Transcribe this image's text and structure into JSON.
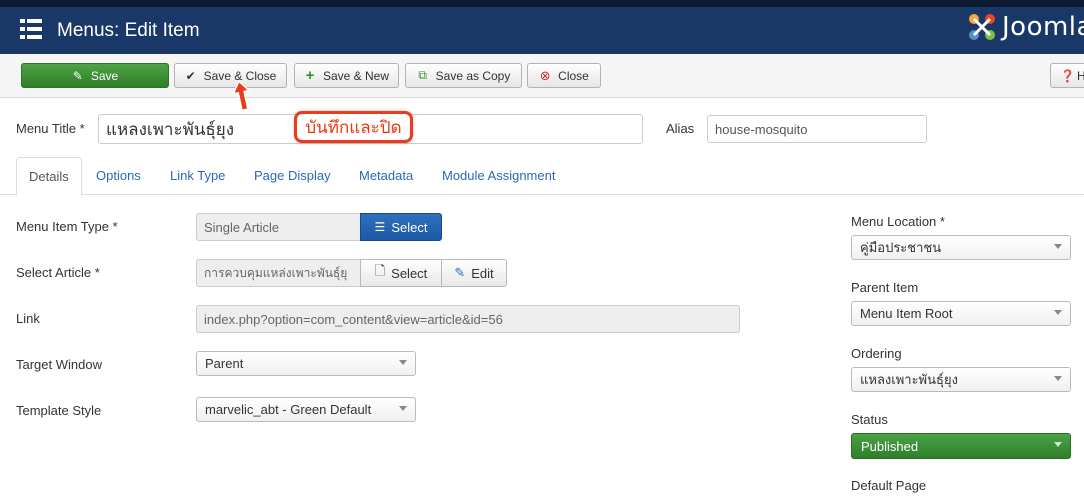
{
  "header": {
    "title": "Menus: Edit Item",
    "logo_text": "Joomla"
  },
  "toolbar": {
    "save": "Save",
    "save_close": "Save & Close",
    "save_new": "Save & New",
    "save_copy": "Save as Copy",
    "close": "Close",
    "help": "H"
  },
  "form": {
    "menu_title_label": "Menu Title *",
    "menu_title_value": "แหลงเพาะพันธุ์ยุง",
    "alias_label": "Alias",
    "alias_value": "house-mosquito"
  },
  "annotation": {
    "callout_text": "บันทึกและปิด"
  },
  "tabs": [
    "Details",
    "Options",
    "Link Type",
    "Page Display",
    "Metadata",
    "Module Assignment"
  ],
  "details": {
    "item_type_label": "Menu Item Type *",
    "item_type_value": "Single Article",
    "item_type_select": "Select",
    "select_article_label": "Select Article *",
    "select_article_value": "การควบคุมแหล่งเพาะพันธุ์ยุ",
    "article_select": "Select",
    "article_edit": "Edit",
    "link_label": "Link",
    "link_value": "index.php?option=com_content&view=article&id=56",
    "target_label": "Target Window",
    "target_value": "Parent",
    "template_label": "Template Style",
    "template_value": "marvelic_abt - Green Default"
  },
  "sidebar": {
    "location_label": "Menu Location *",
    "location_value": "คู่มือประชาชน",
    "parent_label": "Parent Item",
    "parent_value": "Menu Item Root",
    "ordering_label": "Ordering",
    "ordering_value": "แหลงเพาะพันธุ์ยุง",
    "status_label": "Status",
    "status_value": "Published",
    "default_label": "Default Page"
  },
  "colors": {
    "header_bg": "#1a3867",
    "save_green": "#3a8f34",
    "select_blue": "#2163b0",
    "link_blue": "#2a69b8",
    "callout_red": "#ee3a1c"
  }
}
